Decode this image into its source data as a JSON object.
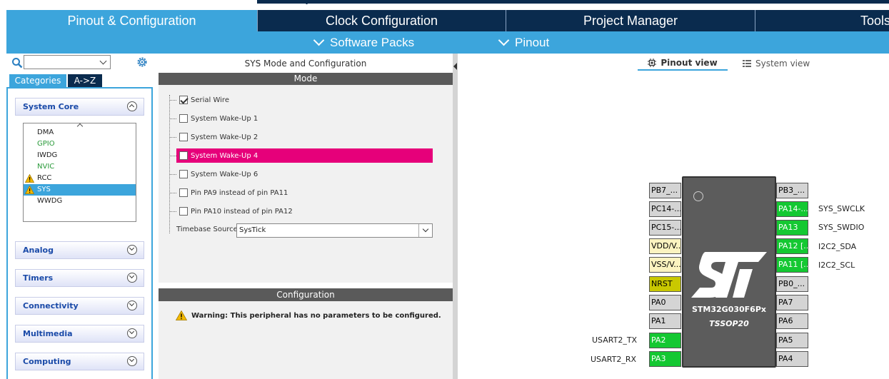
{
  "tabs": {
    "pinout": "Pinout & Configuration",
    "clock": "Clock Configuration",
    "project": "Project Manager",
    "tools": "Tools"
  },
  "subbar": {
    "software_packs": "Software Packs",
    "pinout": "Pinout"
  },
  "left": {
    "search_value": "",
    "categories_tab": "Categories",
    "az_tab": "A->Z",
    "system_core": "System Core",
    "items": [
      {
        "label": "DMA",
        "state": "normal"
      },
      {
        "label": "GPIO",
        "state": "green"
      },
      {
        "label": "IWDG",
        "state": "normal"
      },
      {
        "label": "NVIC",
        "state": "green"
      },
      {
        "label": "RCC",
        "state": "warn"
      },
      {
        "label": "SYS",
        "state": "selected"
      },
      {
        "label": "WWDG",
        "state": "normal"
      }
    ],
    "analog": "Analog",
    "timers": "Timers",
    "connectivity": "Connectivity",
    "multimedia": "Multimedia",
    "computing": "Computing"
  },
  "middle": {
    "title": "SYS Mode and Configuration",
    "mode_header": "Mode",
    "options": [
      {
        "label": "Serial Wire",
        "checked": true
      },
      {
        "label": "System Wake-Up 1",
        "checked": false
      },
      {
        "label": "System Wake-Up 2",
        "checked": false
      },
      {
        "label": "System Wake-Up 4",
        "checked": false
      },
      {
        "label": "System Wake-Up 6",
        "checked": false
      },
      {
        "label": "Pin PA9 instead of pin PA11",
        "checked": false
      },
      {
        "label": "Pin PA10 instead of pin PA12",
        "checked": false
      }
    ],
    "timebase_label": "Timebase Source",
    "timebase_value": "SysTick",
    "config_header": "Configuration",
    "warning": "Warning: This peripheral has no parameters to be configured."
  },
  "right": {
    "pinout_view": "Pinout view",
    "system_view": "System view",
    "chip_name": "STM32G030F6Px",
    "package": "TSSOP20",
    "left_pins": [
      "PB7_...",
      "PC14-...",
      "PC15-...",
      "VDD/V...",
      "VSS/V...",
      "NRST",
      "PA0",
      "PA1",
      "PA2",
      "PA3"
    ],
    "right_pins": [
      "PB3_...",
      "PA14-...",
      "PA13",
      "PA12 [...",
      "PA11 [...",
      "PB0_...",
      "PA7",
      "PA6",
      "PA5",
      "PA4"
    ],
    "left_labels": {
      "PA2": "USART2_TX",
      "PA3": "USART2_RX"
    },
    "right_labels": {
      "PA14": "SYS_SWCLK",
      "PA13": "SYS_SWDIO",
      "PA12": "I2C2_SDA",
      "PA11": "I2C2_SCL"
    },
    "colors": {
      "pin_green": "#14c832",
      "pin_yellow": "#fbf3c0",
      "pin_olive": "#c9c800",
      "highlight": "#e6007a",
      "accent": "#3ca5dc",
      "navy": "#0a2b4e"
    }
  }
}
